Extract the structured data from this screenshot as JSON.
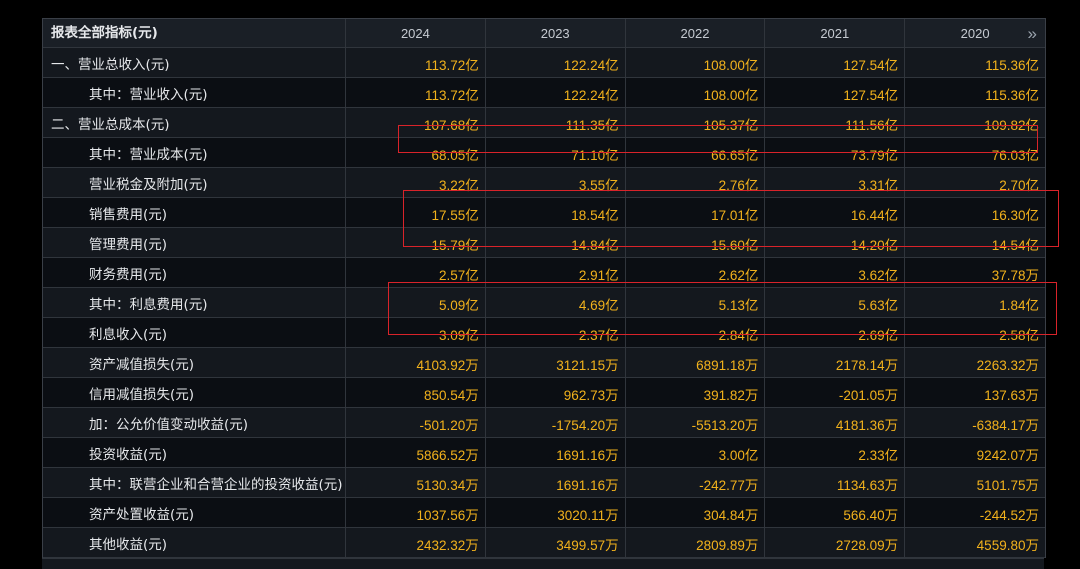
{
  "table": {
    "header_label": "报表全部指标(元)",
    "years": [
      "2024",
      "2023",
      "2022",
      "2021",
      "2020"
    ],
    "more_icon": "double-chevron-right-icon",
    "rows": [
      {
        "label": "一、营业总收入(元)",
        "values": [
          "113.72亿",
          "122.24亿",
          "108.00亿",
          "127.54亿",
          "115.36亿"
        ]
      },
      {
        "label": "其中：营业收入(元)",
        "values": [
          "113.72亿",
          "122.24亿",
          "108.00亿",
          "127.54亿",
          "115.36亿"
        ]
      },
      {
        "label": "二、营业总成本(元)",
        "values": [
          "107.68亿",
          "111.35亿",
          "105.37亿",
          "111.56亿",
          "109.82亿"
        ]
      },
      {
        "label": "其中：营业成本(元)",
        "values": [
          "68.05亿",
          "71.10亿",
          "66.65亿",
          "73.79亿",
          "76.03亿"
        ]
      },
      {
        "label": "营业税金及附加(元)",
        "values": [
          "3.22亿",
          "3.55亿",
          "2.76亿",
          "3.31亿",
          "2.70亿"
        ]
      },
      {
        "label": "销售费用(元)",
        "values": [
          "17.55亿",
          "18.54亿",
          "17.01亿",
          "16.44亿",
          "16.30亿"
        ]
      },
      {
        "label": "管理费用(元)",
        "values": [
          "15.79亿",
          "14.84亿",
          "15.60亿",
          "14.20亿",
          "14.54亿"
        ]
      },
      {
        "label": "财务费用(元)",
        "values": [
          "2.57亿",
          "2.91亿",
          "2.62亿",
          "3.62亿",
          "37.78万"
        ]
      },
      {
        "label": "其中：利息费用(元)",
        "values": [
          "5.09亿",
          "4.69亿",
          "5.13亿",
          "5.63亿",
          "1.84亿"
        ]
      },
      {
        "label": "利息收入(元)",
        "values": [
          "3.09亿",
          "2.37亿",
          "2.84亿",
          "2.69亿",
          "2.58亿"
        ]
      },
      {
        "label": "资产减值损失(元)",
        "values": [
          "4103.92万",
          "3121.15万",
          "6891.18万",
          "2178.14万",
          "2263.32万"
        ]
      },
      {
        "label": "信用减值损失(元)",
        "values": [
          "850.54万",
          "962.73万",
          "391.82万",
          "-201.05万",
          "137.63万"
        ]
      },
      {
        "label": "加：公允价值变动收益(元)",
        "values": [
          "-501.20万",
          "-1754.20万",
          "-5513.20万",
          "4181.36万",
          "-6384.17万"
        ]
      },
      {
        "label": "投资收益(元)",
        "values": [
          "5866.52万",
          "1691.16万",
          "3.00亿",
          "2.33亿",
          "9242.07万"
        ]
      },
      {
        "label": "其中：联营企业和合营企业的投资收益(元)",
        "values": [
          "5130.34万",
          "1691.16万",
          "-242.77万",
          "1134.63万",
          "5101.75万"
        ]
      },
      {
        "label": "资产处置收益(元)",
        "values": [
          "1037.56万",
          "3020.11万",
          "304.84万",
          "566.40万",
          "-244.52万"
        ]
      },
      {
        "label": "其他收益(元)",
        "values": [
          "2432.32万",
          "3499.57万",
          "2809.89万",
          "2728.09万",
          "4559.80万"
        ]
      }
    ]
  },
  "colors": {
    "value": "#f2b21c",
    "highlight": "#d9232a",
    "background": "#000000"
  }
}
